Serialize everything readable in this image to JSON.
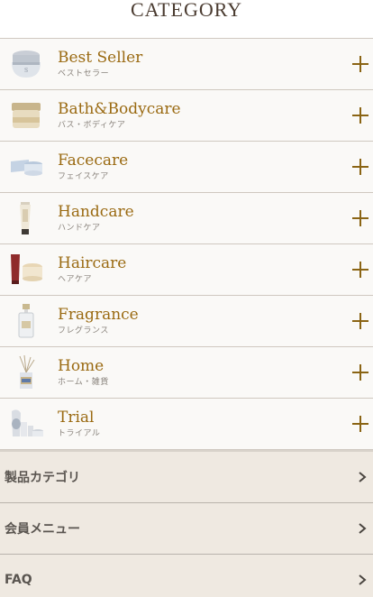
{
  "header": {
    "title": "CATEGORY"
  },
  "categories": [
    {
      "en": "Best Seller",
      "jp": "ベストセラー",
      "icon": "jar-icon"
    },
    {
      "en": "Bath&Bodycare",
      "jp": "バス・ボディケア",
      "icon": "scrub-jar-icon"
    },
    {
      "en": "Facecare",
      "jp": "フェイスケア",
      "icon": "face-jar-icon"
    },
    {
      "en": "Handcare",
      "jp": "ハンドケア",
      "icon": "tube-icon"
    },
    {
      "en": "Haircare",
      "jp": "ヘアケア",
      "icon": "hair-products-icon"
    },
    {
      "en": "Fragrance",
      "jp": "フレグランス",
      "icon": "perfume-bottle-icon"
    },
    {
      "en": "Home",
      "jp": "ホーム・雑貨",
      "icon": "diffuser-icon"
    },
    {
      "en": "Trial",
      "jp": "トライアル",
      "icon": "trial-kit-icon"
    }
  ],
  "menu": [
    {
      "label": "製品カテゴリ"
    },
    {
      "label": "会員メニュー"
    },
    {
      "label": "FAQ"
    }
  ],
  "colors": {
    "accent": "#9a6a12",
    "plus": "#8a6414",
    "text_dark": "#4a3b30"
  }
}
